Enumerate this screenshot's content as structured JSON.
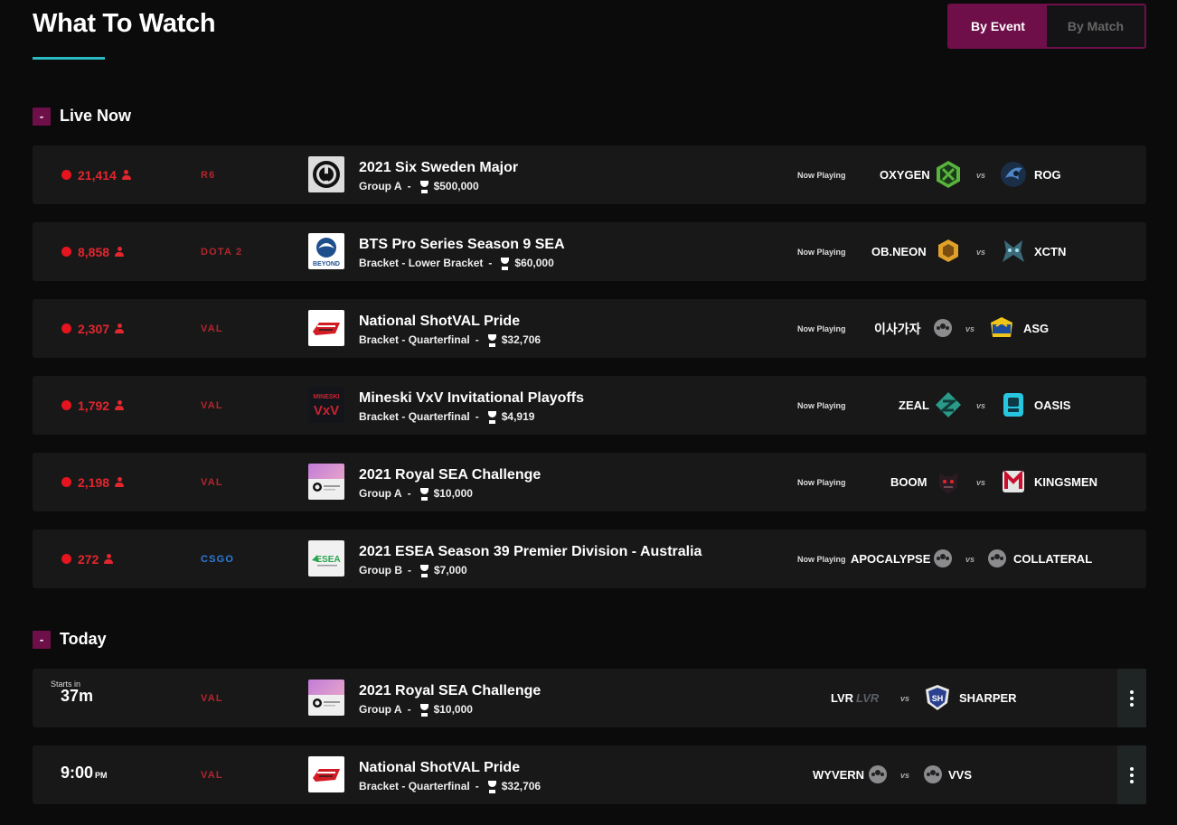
{
  "page": {
    "title": "What To Watch"
  },
  "toggle": {
    "by_event": "By Event",
    "by_match": "By Match"
  },
  "sections": {
    "live": {
      "label": "Live Now",
      "collapse": "-"
    },
    "today": {
      "label": "Today",
      "collapse": "-"
    }
  },
  "live_matches": [
    {
      "viewers": "21,414",
      "game": "R6",
      "event": "2021 Six Sweden Major",
      "stage": "Group A",
      "prize": "$500,000",
      "status": "Now Playing",
      "team1": "OXYGEN",
      "team2": "ROG",
      "vs": "vs"
    },
    {
      "viewers": "8,858",
      "game": "DOTA 2",
      "event": "BTS Pro Series Season 9 SEA",
      "stage": "Bracket - Lower Bracket",
      "prize": "$60,000",
      "status": "Now Playing",
      "team1": "OB.NEON",
      "team2": "XCTN",
      "vs": "vs"
    },
    {
      "viewers": "2,307",
      "game": "VAL",
      "event": "National ShotVAL Pride",
      "stage": "Bracket - Quarterfinal",
      "prize": "$32,706",
      "status": "Now Playing",
      "team1": "이사가자",
      "team2": "ASG",
      "vs": "vs"
    },
    {
      "viewers": "1,792",
      "game": "VAL",
      "event": "Mineski VxV Invitational Playoffs",
      "stage": "Bracket - Quarterfinal",
      "prize": "$4,919",
      "status": "Now Playing",
      "team1": "ZEAL",
      "team2": "OASIS",
      "vs": "vs"
    },
    {
      "viewers": "2,198",
      "game": "VAL",
      "event": "2021 Royal SEA Challenge",
      "stage": "Group A",
      "prize": "$10,000",
      "status": "Now Playing",
      "team1": "BOOM",
      "team2": "KINGSMEN",
      "vs": "vs"
    },
    {
      "viewers": "272",
      "game": "CSGO",
      "event": "2021 ESEA Season 39 Premier Division - Australia",
      "stage": "Group B",
      "prize": "$7,000",
      "status": "Now Playing",
      "team1": "APOCALYPSE",
      "team2": "COLLATERAL",
      "vs": "vs"
    }
  ],
  "today_matches": [
    {
      "starts_label": "Starts in",
      "starts_in": "37m",
      "game": "VAL",
      "event": "2021 Royal SEA Challenge",
      "stage": "Group A",
      "prize": "$10,000",
      "team1": "LVR",
      "team1_logo_text": "LVR",
      "team2": "SHARPER",
      "vs": "vs"
    },
    {
      "time": "9:00",
      "ampm": "PM",
      "game": "VAL",
      "event": "National ShotVAL Pride",
      "stage": "Bracket - Quarterfinal",
      "prize": "$32,706",
      "team1": "WYVERN",
      "team2": "VVS",
      "vs": "vs"
    }
  ],
  "logo_text": {
    "beyond": "BEYOND",
    "mineski": "MINESKI",
    "vxv": "VxV",
    "esea": "ESEA"
  },
  "colors": {
    "accent": "#6e0f4a",
    "underline": "#2bb9c2",
    "live_red": "#e2262d",
    "game_red": "#b3262c",
    "csgo_blue": "#2e7bd6"
  }
}
